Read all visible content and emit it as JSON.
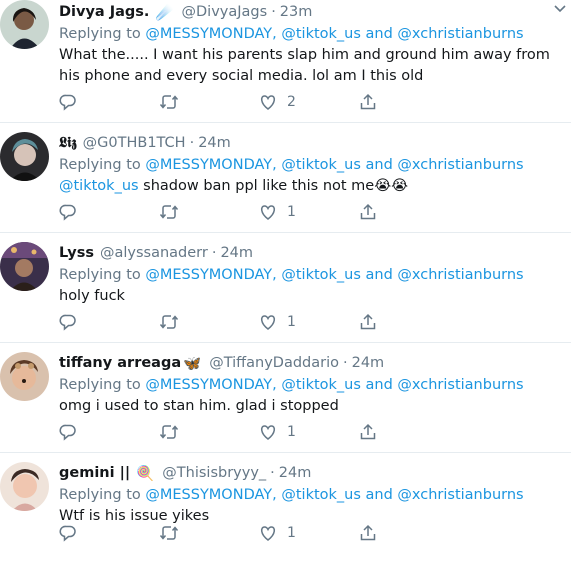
{
  "colors": {
    "link": "#1b95e0",
    "muted": "#657786",
    "text": "#14171a",
    "border": "#e6ecf0"
  },
  "tweets": [
    {
      "name": "Divya Jags.",
      "badge_emoji": "☄️",
      "handle": "@DivyaJags",
      "sep": "·",
      "time": "23m",
      "replying_prefix": "Replying to",
      "mention1": "@MESSYMONDAY,",
      "mention2": "@tiktok_us",
      "and": "and",
      "mention3": "@xchristianburns",
      "text": "What the..... I want his parents slap him and ground him away from his phone and every social media. lol am I this old",
      "like_count": "2"
    },
    {
      "name": "𝕷𝖎𝖟",
      "handle": "@G0THB1TCH",
      "sep": "·",
      "time": "24m",
      "replying_prefix": "Replying to",
      "mention1": "@MESSYMONDAY,",
      "mention2": "@tiktok_us",
      "and": "and",
      "mention3": "@xchristianburns",
      "text_mention": "@tiktok_us",
      "text": "shadow ban ppl like this not me😭😭",
      "like_count": "1"
    },
    {
      "name": "Lyss",
      "handle": "@alyssanaderr",
      "sep": "·",
      "time": "24m",
      "replying_prefix": "Replying to",
      "mention1": "@MESSYMONDAY,",
      "mention2": "@tiktok_us",
      "and": "and",
      "mention3": "@xchristianburns",
      "text": "holy fuck",
      "like_count": "1"
    },
    {
      "name": "tiffany arreaga",
      "badge_emoji": "🦋",
      "handle": "@TiffanyDaddario",
      "sep": "·",
      "time": "24m",
      "replying_prefix": "Replying to",
      "mention1": "@MESSYMONDAY,",
      "mention2": "@tiktok_us",
      "and": "and",
      "mention3": "@xchristianburns",
      "text": "omg i used to stan him. glad i stopped",
      "like_count": "1"
    },
    {
      "name": "gemini ||",
      "badge_emoji": "🍭",
      "handle": "@Thisisbryyy_",
      "sep": "·",
      "time": "24m",
      "replying_prefix": "Replying to",
      "mention1": "@MESSYMONDAY,",
      "mention2": "@tiktok_us",
      "and": "and",
      "mention3": "@xchristianburns",
      "text": "Wtf is his issue yikes",
      "like_count": "1"
    }
  ]
}
